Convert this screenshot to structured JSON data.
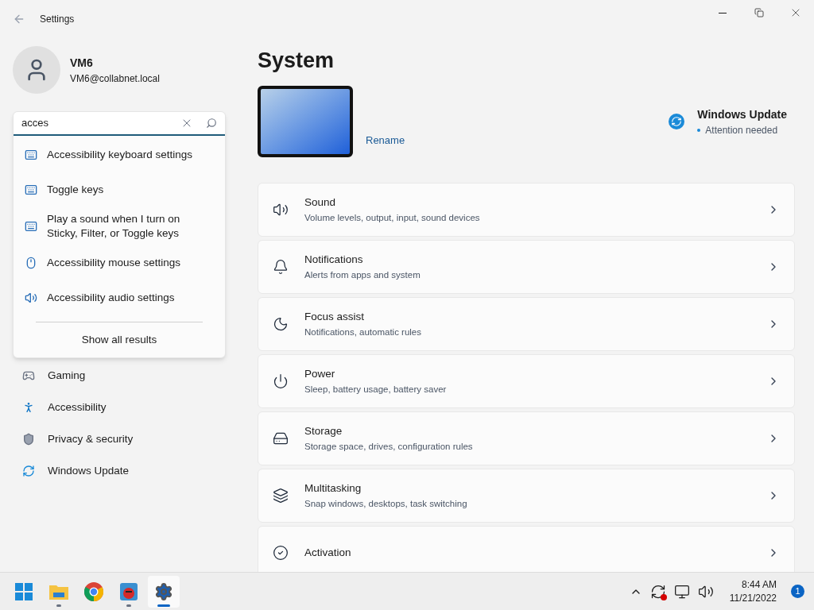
{
  "window": {
    "title": "Settings"
  },
  "user": {
    "name": "VM6",
    "email": "VM6@collabnet.local"
  },
  "search": {
    "value": "acces",
    "results": [
      {
        "label": "Accessibility keyboard settings",
        "kind": "keyboard"
      },
      {
        "label": "Toggle keys",
        "kind": "keyboard"
      },
      {
        "label": "Play a sound when I turn on Sticky, Filter, or Toggle keys",
        "kind": "keyboard"
      },
      {
        "label": "Accessibility mouse settings",
        "kind": "mouse"
      },
      {
        "label": "Accessibility audio settings",
        "kind": "audio"
      }
    ],
    "show_all": "Show all results"
  },
  "sidebar": {
    "items": [
      {
        "label": "Gaming",
        "kind": "gaming"
      },
      {
        "label": "Accessibility",
        "kind": "accessibility"
      },
      {
        "label": "Privacy & security",
        "kind": "privacy"
      },
      {
        "label": "Windows Update",
        "kind": "update"
      }
    ]
  },
  "page": {
    "title": "System",
    "rename": "Rename",
    "update": {
      "title": "Windows Update",
      "status": "Attention needed"
    }
  },
  "settings": [
    {
      "title": "Sound",
      "subtitle": "Volume levels, output, input, sound devices",
      "kind": "sound"
    },
    {
      "title": "Notifications",
      "subtitle": "Alerts from apps and system",
      "kind": "notifications"
    },
    {
      "title": "Focus assist",
      "subtitle": "Notifications, automatic rules",
      "kind": "focus"
    },
    {
      "title": "Power",
      "subtitle": "Sleep, battery usage, battery saver",
      "kind": "power"
    },
    {
      "title": "Storage",
      "subtitle": "Storage space, drives, configuration rules",
      "kind": "storage"
    },
    {
      "title": "Multitasking",
      "subtitle": "Snap windows, desktops, task switching",
      "kind": "multitasking"
    },
    {
      "title": "Activation",
      "kind": "activation"
    }
  ],
  "taskbar": {
    "apps": [
      {
        "kind": "start",
        "running": false,
        "selected": false
      },
      {
        "kind": "explorer",
        "running": true,
        "selected": false
      },
      {
        "kind": "chrome",
        "running": false,
        "selected": false
      },
      {
        "kind": "game",
        "running": true,
        "selected": false
      },
      {
        "kind": "settings",
        "running": true,
        "selected": true
      }
    ],
    "time": "8:44 AM",
    "date": "11/21/2022",
    "notifications": "1"
  }
}
